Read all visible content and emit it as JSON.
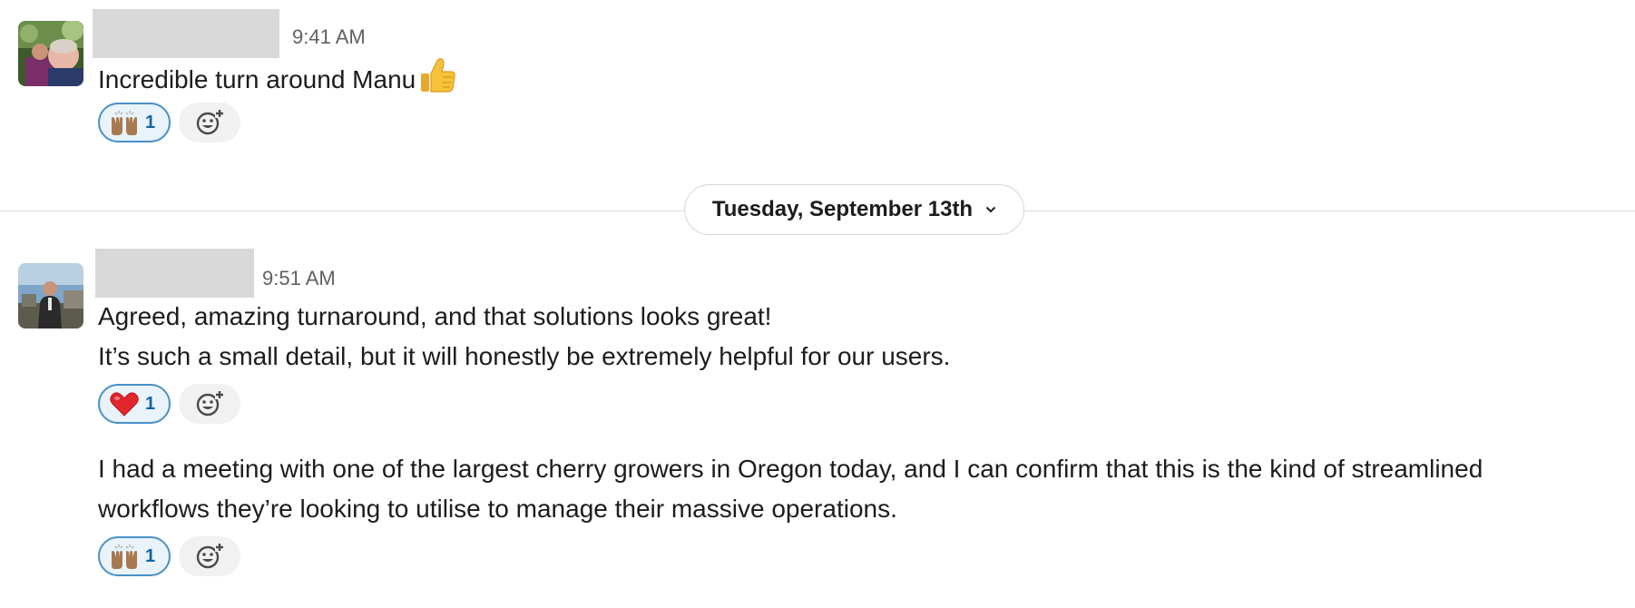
{
  "messages": [
    {
      "time": "9:41 AM",
      "lines": [
        "Incredible turn around Manu"
      ],
      "inline_emoji": "thumbs-up",
      "reaction": {
        "emoji": "raising-hands",
        "count": "1"
      }
    },
    {
      "time": "9:51 AM",
      "lines": [
        "Agreed, amazing turnaround, and that solutions looks great!",
        "It’s such a small detail, but it will honestly be extremely helpful for our users."
      ],
      "reaction": {
        "emoji": "red-heart",
        "count": "1"
      }
    },
    {
      "lines": [
        "I had a meeting with one of the largest cherry growers in Oregon today, and I can confirm that this is the kind of streamlined",
        "workflows they’re looking to utilise to manage their massive operations."
      ],
      "reaction": {
        "emoji": "raising-hands",
        "count": "1"
      }
    }
  ],
  "date_divider": {
    "label": "Tuesday, September 13th",
    "icon": "chevron-down-icon"
  },
  "add_reaction_icon": "add-reaction-icon",
  "colors": {
    "reaction_border": "#4a90c8",
    "reaction_bg": "#e8f3fa",
    "reaction_count": "#1264a3",
    "timestamp": "#616061"
  }
}
